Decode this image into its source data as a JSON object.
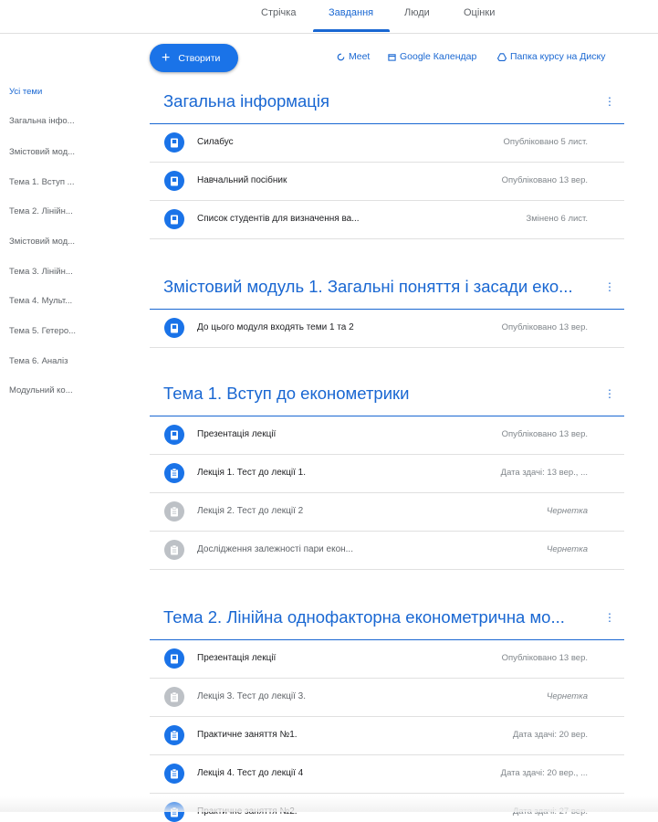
{
  "tabs": [
    {
      "label": "Стрічка"
    },
    {
      "label": "Завдання"
    },
    {
      "label": "Люди"
    },
    {
      "label": "Оцінки"
    }
  ],
  "create_button": {
    "label": "Створити"
  },
  "toplinks": [
    {
      "label": "Meet",
      "icon": "meet-icon"
    },
    {
      "label": "Google Календар",
      "icon": "calendar-icon"
    },
    {
      "label": "Папка курсу на Диску",
      "icon": "drive-icon"
    }
  ],
  "sidebar": {
    "items": [
      {
        "label": "Усі теми"
      },
      {
        "label": "Загальна інфо..."
      },
      {
        "label": "Змістовий мод..."
      },
      {
        "label": "Тема 1. Вступ ..."
      },
      {
        "label": "Тема 2. Лінійн..."
      },
      {
        "label": "Змістовий мод..."
      },
      {
        "label": "Тема 3. Лінійн..."
      },
      {
        "label": "Тема 4. Мульт..."
      },
      {
        "label": "Тема 5. Гетеро..."
      },
      {
        "label": "Тема 6. Аналіз"
      },
      {
        "label": "Модульний ко..."
      }
    ]
  },
  "sections": [
    {
      "title": "Загальна інформація",
      "items": [
        {
          "title": "Силабус",
          "status": "Опубліковано 5 лист.",
          "icon": "material-icon"
        },
        {
          "title": "Навчальний посібник",
          "status": "Опубліковано 13 вер.",
          "icon": "material-icon"
        },
        {
          "title": "Список студентів для визначення ва...",
          "status": "Змінено 6 лист.",
          "icon": "material-icon"
        }
      ]
    },
    {
      "title": "Змістовий модуль 1. Загальні поняття і засади еко...",
      "items": [
        {
          "title": "До цього модуля входять теми 1 та 2",
          "status": "Опубліковано 13 вер.",
          "icon": "material-icon"
        }
      ]
    },
    {
      "title": "Тема 1. Вступ до економетрики",
      "items": [
        {
          "title": "Презентація лекції",
          "status": "Опубліковано 13 вер.",
          "icon": "material-icon"
        },
        {
          "title": "Лекція 1. Тест до лекції 1.",
          "status": "Дата здачі: 13 вер., ...",
          "icon": "assignment-icon"
        },
        {
          "title": "Лекція 2. Тест до лекції 2",
          "status": "Чернетка",
          "icon": "assignment-icon"
        },
        {
          "title": "Дослідження залежності пари екон...",
          "status": "Чернетка",
          "icon": "assignment-icon"
        }
      ]
    },
    {
      "title": "Тема 2. Лінійна однофакторна економетрична мо...",
      "items": [
        {
          "title": "Презентація лекції",
          "status": "Опубліковано 13 вер.",
          "icon": "material-icon"
        },
        {
          "title": "Лекція 3. Тест до лекції 3.",
          "status": "Чернетка",
          "icon": "assignment-icon"
        },
        {
          "title": "Практичне заняття №1.",
          "status": "Дата здачі: 20 вер.",
          "icon": "assignment-icon"
        },
        {
          "title": "Лекція 4. Тест до лекції 4",
          "status": "Дата здачі: 20 вер., ...",
          "icon": "assignment-icon"
        },
        {
          "title": "Практичне заняття №2.",
          "status": "Дата здачі: 27 вер.",
          "icon": "assignment-icon"
        }
      ]
    }
  ],
  "colors": {
    "accent": "#1967d2",
    "button": "#1a73e8",
    "draft_icon": "#bdc1c6",
    "divider": "#e0e0e0"
  }
}
